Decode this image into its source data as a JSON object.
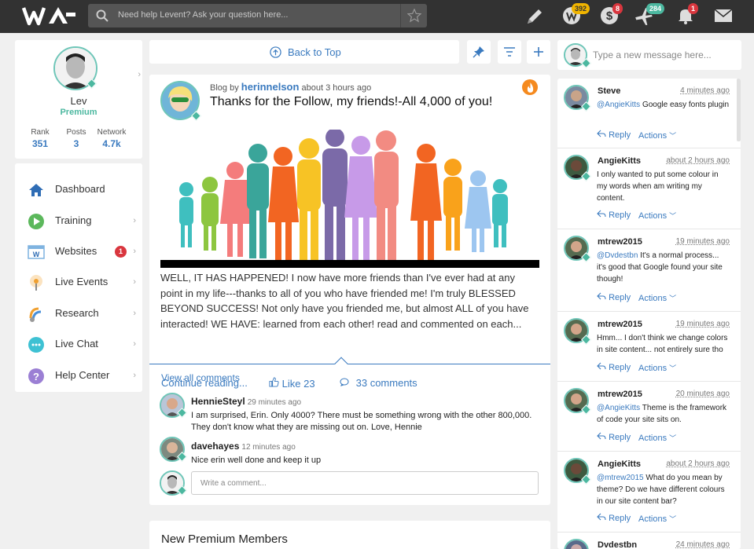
{
  "topbar": {
    "search_placeholder": "Need help Levent? Ask your question here...",
    "badges": {
      "credits": "392",
      "earnings": "8",
      "flights": "284",
      "notifications": "1"
    }
  },
  "profile": {
    "name": "Lev",
    "membership": "Premium",
    "stats": [
      {
        "label": "Rank",
        "value": "351"
      },
      {
        "label": "Posts",
        "value": "3"
      },
      {
        "label": "Network",
        "value": "4.7k"
      }
    ]
  },
  "nav": {
    "items": [
      {
        "label": "Dashboard",
        "icon": "home-icon"
      },
      {
        "label": "Training",
        "icon": "play-icon"
      },
      {
        "label": "Websites",
        "icon": "websites-icon",
        "badge": "1"
      },
      {
        "label": "Live Events",
        "icon": "live-events-icon"
      },
      {
        "label": "Research",
        "icon": "research-icon"
      },
      {
        "label": "Live Chat",
        "icon": "chat-icon"
      },
      {
        "label": "Help Center",
        "icon": "help-icon"
      }
    ]
  },
  "feed": {
    "back_to_top": "Back to Top",
    "post": {
      "meta_prefix": "Blog by",
      "author": "herinnelson",
      "time": "about 3 hours ago",
      "title": "Thanks for the Follow, my friends!-All 4,000 of you!",
      "body": "WELL, IT HAS HAPPENED! I now have more friends than I've ever had at any point in my life---thanks to all of you who have friended me! I'm truly BLESSED BEYOND SUCCESS! Not only have you friended me, but almost ALL of you have interacted! WE HAVE: learned from each other! read and commented on each...",
      "continue": "Continue reading...",
      "likes": "Like 23",
      "comments": "33 comments",
      "view_all": "View all comments",
      "comment_list": [
        {
          "name": "HennieSteyl",
          "time": "29 minutes ago",
          "text": "I am surprised, Erin. Only 4000? There must be something wrong with the other 800,000. They don't know what they are missing out on. Love, Hennie"
        },
        {
          "name": "davehayes",
          "time": "12 minutes ago",
          "text": "Nice erin well done and keep it up"
        }
      ],
      "write_placeholder": "Write a comment..."
    },
    "next_section_title": "New Premium Members"
  },
  "chat": {
    "placeholder": "Type a new message here...",
    "reply_label": "Reply",
    "actions_label": "Actions",
    "messages": [
      {
        "name": "Steve",
        "time": "4 minutes ago",
        "mention": "@AngieKitts",
        "text": " Google easy fonts plugin"
      },
      {
        "name": "AngieKitts",
        "time": "about 2 hours ago",
        "mention": "",
        "text": "I only wanted to put some colour in my words when am writing my content."
      },
      {
        "name": "mtrew2015",
        "time": "19 minutes ago",
        "mention": "@Dvdestbn",
        "text": " It's a normal process... it's good that Google found your site though!"
      },
      {
        "name": "mtrew2015",
        "time": "19 minutes ago",
        "mention": "",
        "text": "Hmm... I don't think we change colors in site content... not entirely sure tho"
      },
      {
        "name": "mtrew2015",
        "time": "20 minutes ago",
        "mention": "@AngieKitts",
        "text": " Theme is the framework of code your site sits on."
      },
      {
        "name": "AngieKitts",
        "time": "about 2 hours ago",
        "mention": "@mtrew2015",
        "text": " What do you mean by theme? Do we have different colours in our site content bar?"
      },
      {
        "name": "Dvdestbn",
        "time": "24 minutes ago",
        "mention": "",
        "text": ""
      }
    ]
  },
  "colors": {
    "accent": "#3a7abf",
    "teal": "#4cb8a0",
    "topbar": "#323232"
  }
}
